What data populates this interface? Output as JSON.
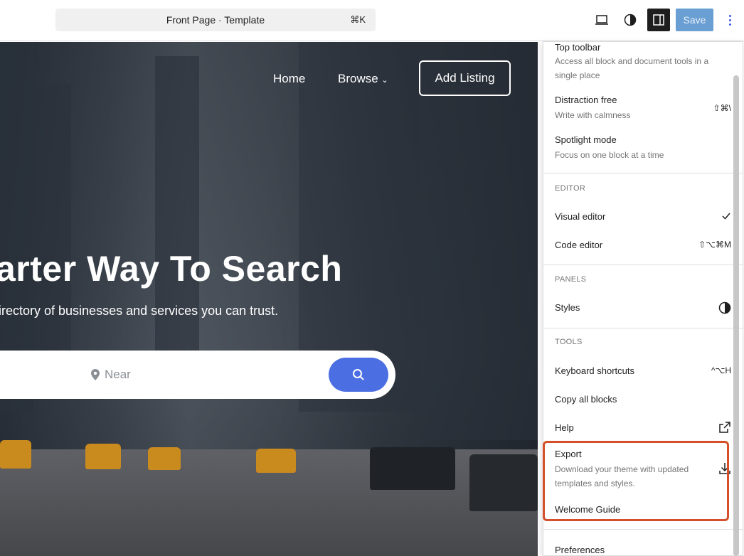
{
  "topbar": {
    "document_title": "Front Page · Template",
    "command_shortcut": "⌘K",
    "save_label": "Save",
    "icons": [
      "desktop-view-icon",
      "styles-contrast-icon",
      "sidebar-settings-icon",
      "options-kebab-icon"
    ]
  },
  "hero": {
    "nav": {
      "home": "Home",
      "browse": "Browse",
      "add_listing": "Add Listing"
    },
    "headline": "arter Way To Search",
    "subline": "irectory of businesses and services you can trust.",
    "near_placeholder": "Near"
  },
  "menu": {
    "view_items": [
      {
        "label": "Top toolbar",
        "description": "Access all block and document tools in a single place"
      },
      {
        "label": "Distraction free",
        "description": "Write with calmness",
        "shortcut": "⇧⌘\\"
      },
      {
        "label": "Spotlight mode",
        "description": "Focus on one block at a time"
      }
    ],
    "editor": {
      "heading": "EDITOR",
      "visual_editor": "Visual editor",
      "code_editor": "Code editor",
      "code_shortcut": "⇧⌥⌘M"
    },
    "panels": {
      "heading": "PANELS",
      "styles": "Styles"
    },
    "tools": {
      "heading": "TOOLS",
      "keyboard_shortcuts": "Keyboard shortcuts",
      "keyboard_shortcut_keys": "^⌥H",
      "copy_all_blocks": "Copy all blocks",
      "help": "Help",
      "export": "Export",
      "export_description": "Download your theme with updated templates and styles.",
      "welcome_guide": "Welcome Guide"
    },
    "preferences": "Preferences"
  },
  "colors": {
    "accent": "#3858e9",
    "highlight": "#d4502c",
    "search_button": "#4b6fe2"
  }
}
